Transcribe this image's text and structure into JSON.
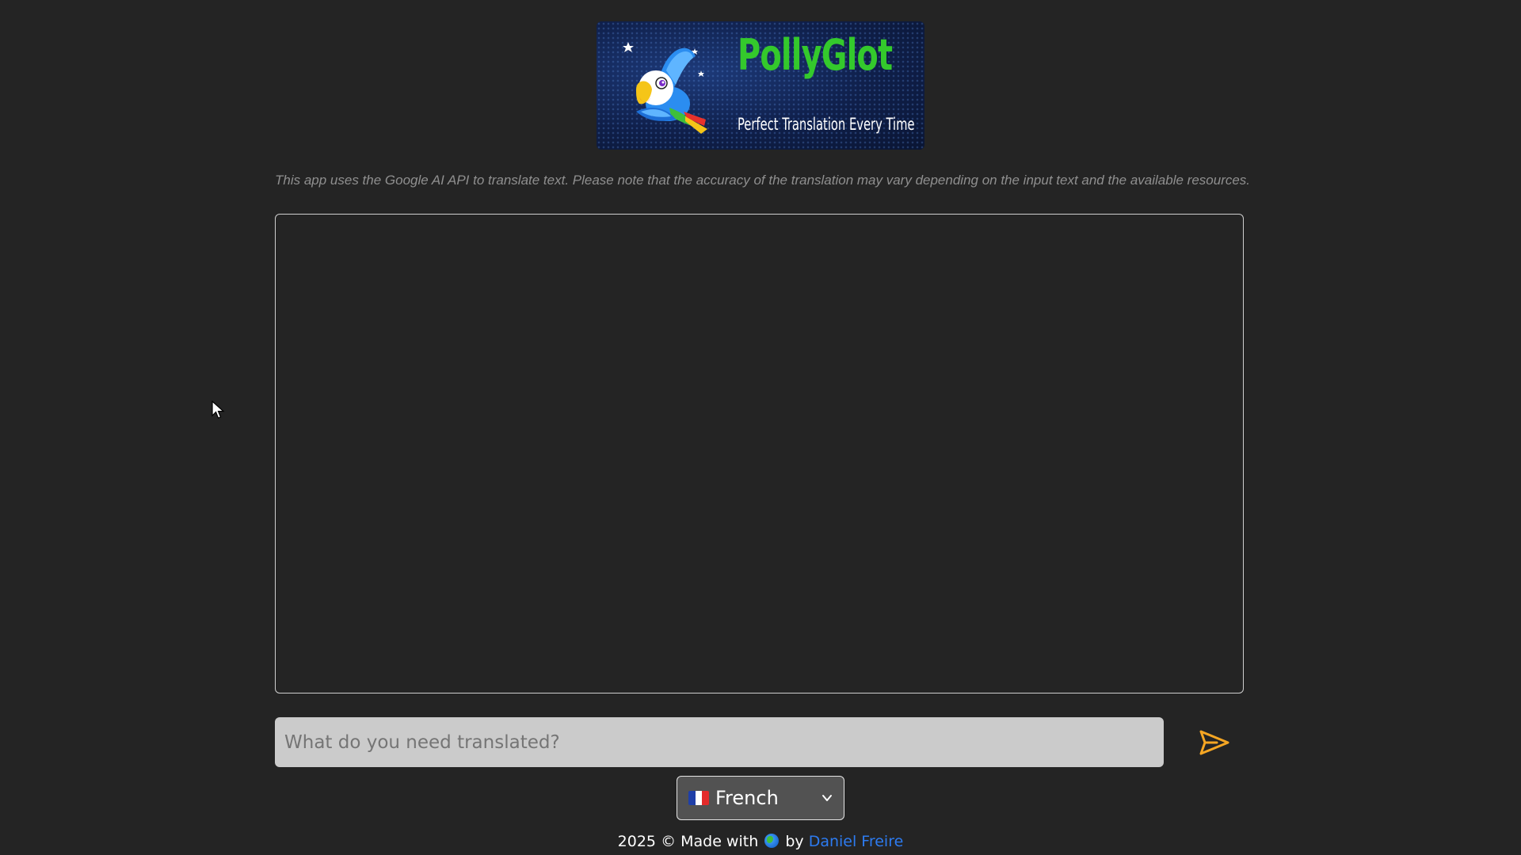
{
  "logo": {
    "title": "PollyGlot",
    "subtitle": "Perfect Translation Every Time",
    "icon": "parrot-logo-icon"
  },
  "disclaimer": "This app uses the Google AI API to translate text. Please note that the accuracy of the translation may vary depending on the input text and the available resources.",
  "output": {
    "text": ""
  },
  "input": {
    "value": "",
    "placeholder": "What do you need translated?"
  },
  "send_button": {
    "icon": "send-icon",
    "color": "#f5a623"
  },
  "language": {
    "selected": "French",
    "flag": "france-flag-icon"
  },
  "footer": {
    "prefix": "2025 © Made with",
    "emoji": "globe-icon",
    "by": "by",
    "author": "Daniel Freire"
  },
  "colors": {
    "background": "#242424",
    "logo_title": "#34c92c",
    "link": "#2d7bf0",
    "accent": "#f5a623"
  }
}
